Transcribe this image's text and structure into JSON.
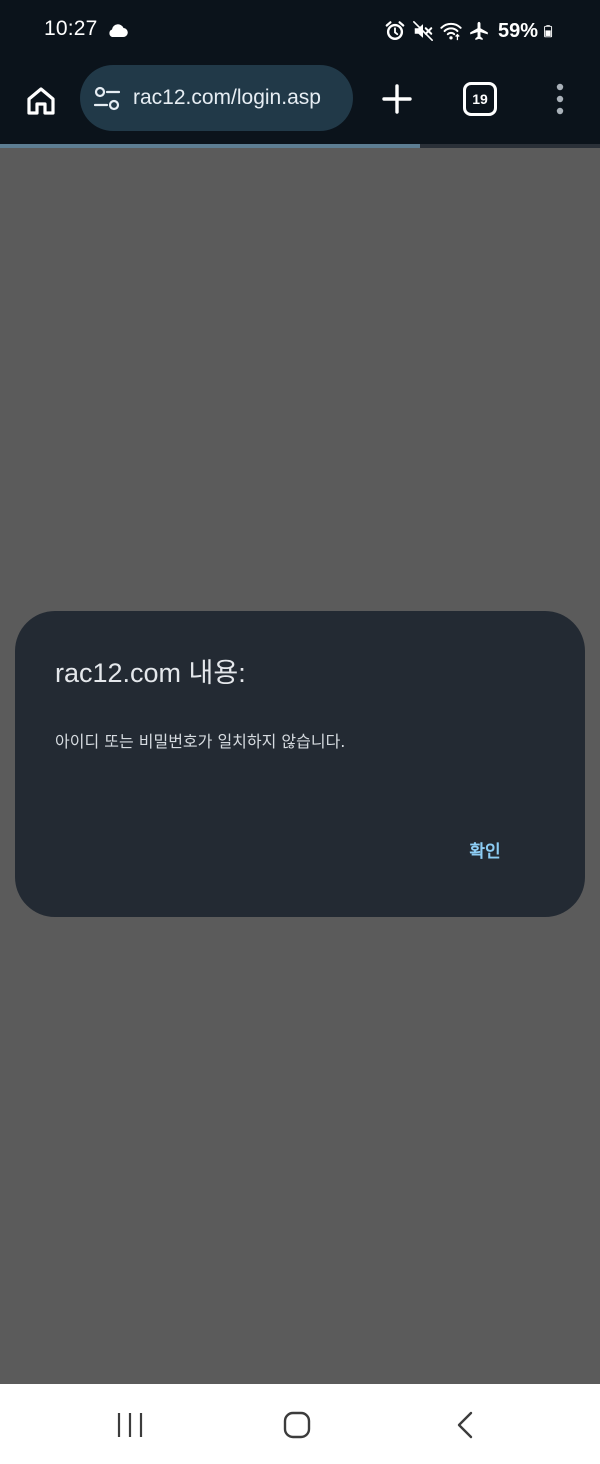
{
  "status_bar": {
    "time": "10:27",
    "battery": "59%",
    "icons": [
      "cloud-icon",
      "alarm-icon",
      "mute-icon",
      "wifi-icon",
      "airplane-icon",
      "battery-icon"
    ]
  },
  "toolbar": {
    "url": "rac12.com/login.asp",
    "tab_count": "19",
    "page_load_progress": 0.7,
    "icons": [
      "home-icon",
      "tune-icon",
      "plus-icon",
      "tab-switcher-icon",
      "more-vert-icon"
    ]
  },
  "dialog": {
    "title": "rac12.com 내용:",
    "message": "아이디 또는 비밀번호가 일치하지 않습니다.",
    "ok_label": "확인"
  },
  "nav_bar": {
    "icons": [
      "recents-icon",
      "home-nav-icon",
      "back-icon"
    ]
  },
  "colors": {
    "chrome_bg": "#0b131b",
    "omnibox_bg": "#213948",
    "page_scrim": "#5b5b5b",
    "dialog_bg": "#232a33",
    "accent": "#8dcdf5"
  }
}
